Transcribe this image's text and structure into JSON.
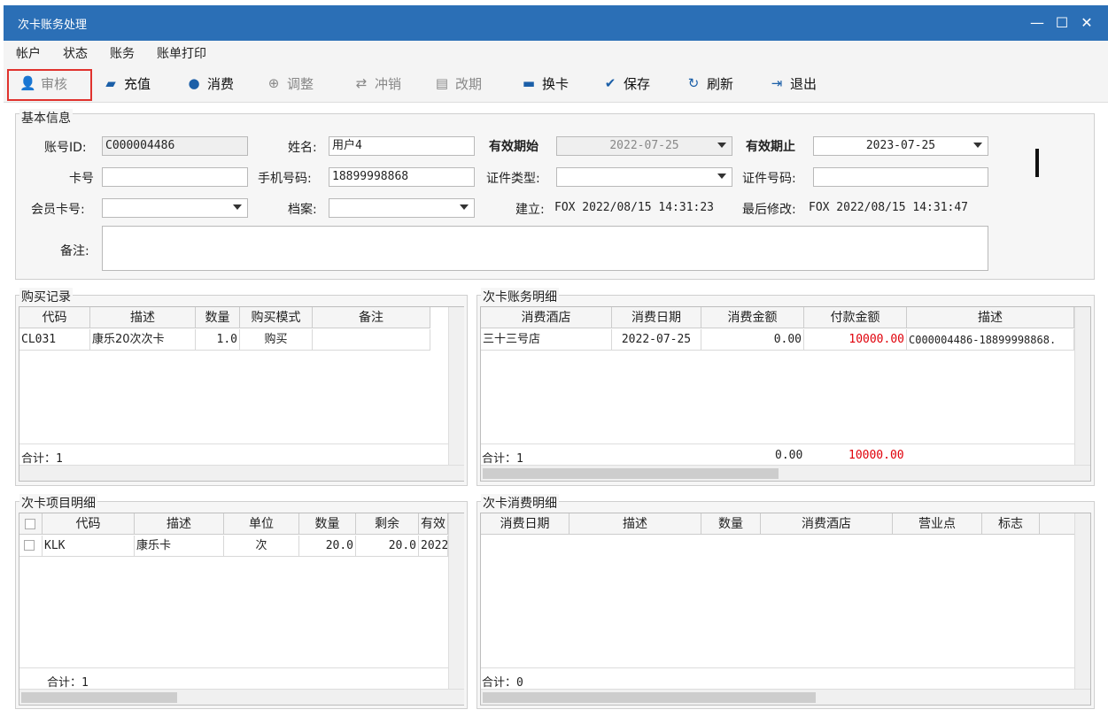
{
  "window": {
    "title": "次卡账务处理"
  },
  "menu": [
    "帐户",
    "状态",
    "账务",
    "账单打印"
  ],
  "toolbar": {
    "audit": "审核",
    "recharge": "充值",
    "consume": "消费",
    "adjust": "调整",
    "reverse": "冲销",
    "change_date": "改期",
    "change_card": "换卡",
    "save": "保存",
    "refresh": "刷新",
    "exit": "退出"
  },
  "basic": {
    "title": "基本信息",
    "account_id_label": "账号ID:",
    "account_id": "C000004486",
    "name_label": "姓名:",
    "name": "用户4",
    "valid_from_label": "有效期始",
    "valid_from": "2022-07-25",
    "valid_to_label": "有效期止",
    "valid_to": "2023-07-25",
    "card_no_label": "卡号",
    "card_no": "",
    "phone_label": "手机号码:",
    "phone": "18899998868",
    "id_type_label": "证件类型:",
    "id_type": "",
    "id_no_label": "证件号码:",
    "id_no": "",
    "member_card_label": "会员卡号:",
    "member_card": "",
    "archive_label": "档案:",
    "archive": "",
    "created_label": "建立:",
    "created": "FOX  2022/08/15 14:31:23",
    "modified_label": "最后修改:",
    "modified": "FOX  2022/08/15 14:31:47",
    "remark_label": "备注:",
    "remark": ""
  },
  "purchase": {
    "title": "购买记录",
    "headers": [
      "代码",
      "描述",
      "数量",
      "购买模式",
      "备注"
    ],
    "rows": [
      [
        "CL031",
        "康乐20次次卡",
        "1.0",
        "购买",
        ""
      ]
    ],
    "footer": "合计：1"
  },
  "account_detail": {
    "title": "次卡账务明细",
    "headers": [
      "消费酒店",
      "消费日期",
      "消费金额",
      "付款金额",
      "描述"
    ],
    "rows": [
      [
        "三十三号店",
        "2022-07-25",
        "0.00",
        "10000.00",
        "C000004486-18899998868."
      ]
    ],
    "footer": "合计：1",
    "footer_consume": "0.00",
    "footer_pay": "10000.00"
  },
  "items": {
    "title": "次卡项目明细",
    "headers": [
      "代码",
      "描述",
      "单位",
      "数量",
      "剩余",
      "有效"
    ],
    "rows": [
      [
        "KLK",
        "康乐卡",
        "次",
        "20.0",
        "20.0",
        "2022"
      ]
    ],
    "footer": "合计：1"
  },
  "consume_detail": {
    "title": "次卡消费明细",
    "headers": [
      "消费日期",
      "描述",
      "数量",
      "消费酒店",
      "营业点",
      "标志"
    ],
    "footer": "合计：0"
  },
  "colors": {
    "titlebar": "#2b6fb6",
    "highlight": "#e0322d",
    "amount_red": "#e0000a"
  }
}
